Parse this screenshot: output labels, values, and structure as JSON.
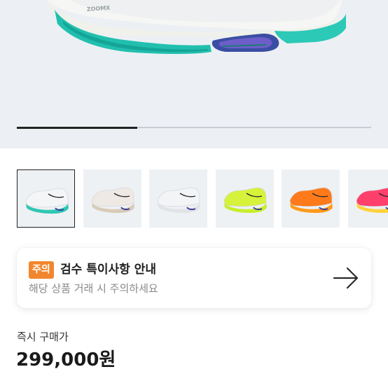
{
  "hero": {
    "image_icon": "running-shoe-zoomx-image",
    "brand_text": "ZOOMX",
    "slider_progress": 0.34
  },
  "thumbnails": [
    {
      "icon": "shoe-white-teal-image",
      "selected": true,
      "colors": {
        "upper": "#f4f5f7",
        "sole": "#2fc7b4"
      }
    },
    {
      "icon": "shoe-white-pink-image",
      "selected": false,
      "colors": {
        "upper": "#efe9e4",
        "sole": "#d9cbb9"
      }
    },
    {
      "icon": "shoe-white-black-image",
      "selected": false,
      "colors": {
        "upper": "#f3f4f6",
        "sole": "#e1e3e6"
      }
    },
    {
      "icon": "shoe-volt-image",
      "selected": false,
      "colors": {
        "upper": "#d6f23a",
        "sole": "#c7ee2c"
      }
    },
    {
      "icon": "shoe-orange-image",
      "selected": false,
      "colors": {
        "upper": "#ff7a1a",
        "sole": "#ff9a1a"
      }
    },
    {
      "icon": "shoe-pink-yellow-image",
      "selected": false,
      "colors": {
        "upper": "#ff3f6c",
        "sole": "#ffd23d"
      }
    }
  ],
  "notice": {
    "badge": "주의",
    "title": "검수 특이사항 안내",
    "subtitle": "해당 상품 거래 시 주의하세요",
    "arrow_icon": "arrow-right-icon"
  },
  "price": {
    "label": "즉시 구매가",
    "value": "299,000원"
  },
  "colors": {
    "badge": "#f2862e",
    "hero_background": "#ecf0f4",
    "thumbnail_background": "#eef1f4"
  }
}
